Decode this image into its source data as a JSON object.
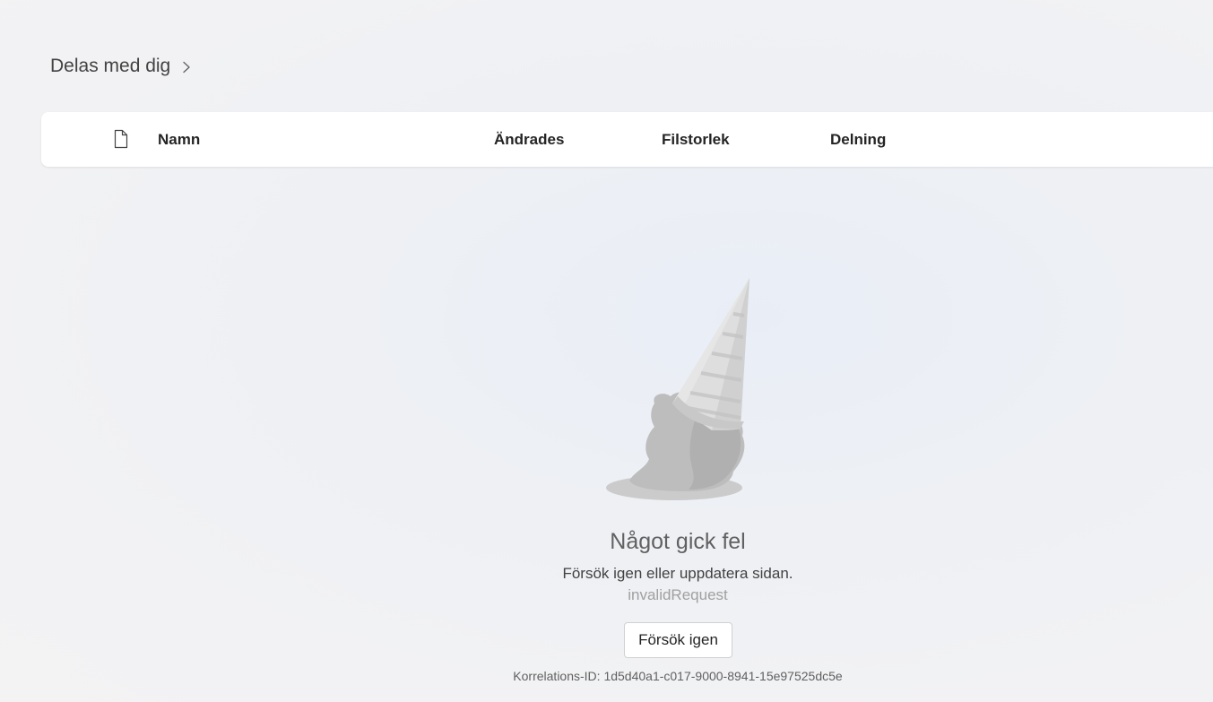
{
  "breadcrumb": {
    "title": "Delas med dig",
    "chevron_icon": "chevron-right-icon"
  },
  "table_header": {
    "file_type_icon": "document-icon",
    "columns": [
      {
        "label": "Namn"
      },
      {
        "label": "Ändrades"
      },
      {
        "label": "Filstorlek"
      },
      {
        "label": "Delning"
      }
    ]
  },
  "error": {
    "illustration": "dropped-ice-cream-cone",
    "title": "Något gick fel",
    "message": "Försök igen eller uppdatera sidan.",
    "code": "invalidRequest",
    "retry_label": "Försök igen",
    "correlation_id": "Korrelations-ID: 1d5d40a1-c017-9000-8941-15e97525dc5e"
  }
}
